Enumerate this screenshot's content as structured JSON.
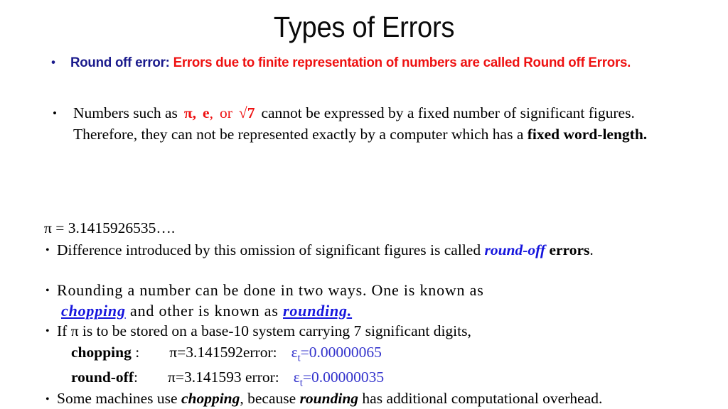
{
  "slide": {
    "title": "Types of Errors",
    "bullet_glyph": "•"
  },
  "round_off_error": {
    "label": "Round off error:",
    "definition": "Errors due to finite representation of numbers are called Round off Errors.",
    "label_color": "#1a1a8c",
    "definition_color": "#ee1111"
  },
  "numbers_bullet": {
    "lead": "Numbers such as",
    "sym_pi": "π,",
    "sym_e": "e",
    "sym_e_comma": ",",
    "sym_or": "or",
    "sym_root7": "√7",
    "rest_1": "cannot be expressed by a fixed number of significant figures. Therefore, they can not be represented exactly by a computer which has a ",
    "emphasis": "fixed word-length."
  },
  "pi_value": {
    "text": "π = 3.1415926535…."
  },
  "difference_bullet": {
    "before": "Difference introduced by this omission of significant figures is called ",
    "emph_blue": "round-off",
    "emph_bold": "errors",
    "after": "."
  },
  "rounding_bullet": {
    "line1": "Rounding a number can be done in two ways. One is known as",
    "emph_chopping": "chopping",
    "mid": " and other is  known as ",
    "emph_rounding": "rounding",
    "after": "."
  },
  "ifpi_bullet": {
    "text": "If π is to be stored on a base-10 system carrying 7 significant digits,"
  },
  "error_table": {
    "rows": [
      {
        "label": "chopping",
        "sep": ":",
        "pi_expr": "π=3.141592",
        "error_label": "error:",
        "error_sym": "ε",
        "error_sub": "t",
        "error_value": "=0.00000065"
      },
      {
        "label": "round-off",
        "sep": ":",
        "pi_expr": "π=3.141593",
        "error_label": "error:",
        "error_sym": "ε",
        "error_sub": "t",
        "error_value": "=0.00000035"
      }
    ],
    "value_color": "#3333cc"
  },
  "machines_bullet": {
    "p1": "Some machines use ",
    "emph_chopping": "chopping",
    "p2": ", because ",
    "emph_rounding": "rounding",
    "p3": " has additional computational overhead."
  }
}
